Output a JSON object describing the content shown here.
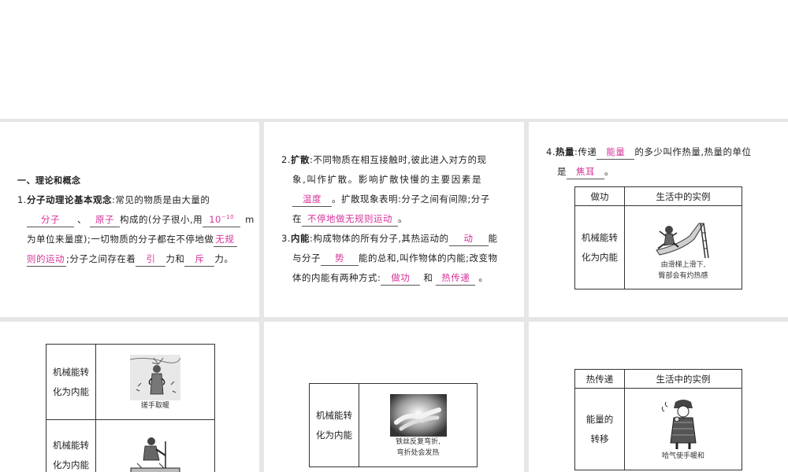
{
  "p1": {
    "heading": "一、理论和概念",
    "l1_num": "1.",
    "l1_term": "分子动理论基本观念",
    "l1_text": ":常见的物质是由大量的",
    "b_molecule": "分子",
    "sep1": "、",
    "b_atom": "原子",
    "l2_text": "构成的(分子很小,用",
    "b_size_base": "10",
    "b_size_exp": "−10",
    "l2_unit": "m",
    "l3_text": "为单位来量度);一切物质的分子都在不停地做",
    "b_motion_1": "无规",
    "b_motion_2": "则的运动",
    "l4_text": ";分子之间存在着",
    "b_attract": "引",
    "l4_and": "力和",
    "b_repel": "斥",
    "l4_end": "力。"
  },
  "p2": {
    "l1_num": "2.",
    "l1_term": "扩散",
    "l1_text": ":不同物质在相互接触时,彼此进入对方的现",
    "l2_text": "象,叫作扩散。影响扩散快慢的主要因素是",
    "b_temp": "温度",
    "l3_text": "。扩散现象表明:分子之间有间隙;分子",
    "l4_pre": "在",
    "b_motion": "不停地做无规则运动",
    "l4_end": "。",
    "l5_num": "3.",
    "l5_term": "内能",
    "l5_text": ":构成物体的所有分子,其热运动的",
    "b_kinetic": "动",
    "l5_end": "能",
    "l6_pre": "与分子",
    "b_potential": "势",
    "l6_text": "能的总和,叫作物体的内能;改变物",
    "l7_text": "体的内能有两种方式:",
    "b_work": "做功",
    "l7_and": "和",
    "b_heat": "热传递",
    "l7_end": "。"
  },
  "p3": {
    "l1_num": "4.",
    "l1_term": "热量",
    "l1_pre": ":传递",
    "b_energy": "能量",
    "l1_text": "的多少叫作热量,热量的单位",
    "l2_pre": "是",
    "b_joule": "焦耳",
    "l2_end": "。",
    "table": {
      "h1": "做功",
      "h2": "生活中的实例",
      "row_label_1": "机械能转",
      "row_label_2": "化为内能",
      "caption_1": "由滑梯上滑下,",
      "caption_2": "臀部会有灼热感"
    }
  },
  "p4": {
    "row1_label_1": "机械能转",
    "row1_label_2": "化为内能",
    "row1_caption": "搓手取暖",
    "row2_label_1": "机械能转",
    "row2_label_2": "化为内能"
  },
  "p5": {
    "label_1": "机械能转",
    "label_2": "化为内能",
    "caption_1": "铁丝反复弯折,",
    "caption_2": "弯折处会发热"
  },
  "p6": {
    "h1": "热传递",
    "h2": "生活中的实例",
    "label_1": "能量的",
    "label_2": "转移",
    "caption": "哈气使手暖和"
  },
  "colors": {
    "answer": "#d6339a",
    "divider": "#e6e6e6"
  }
}
